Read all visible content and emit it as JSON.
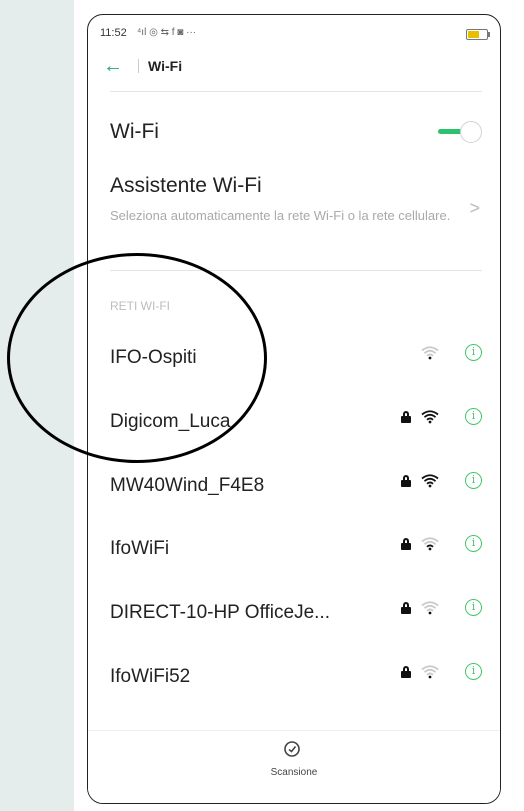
{
  "status": {
    "time": "11:52",
    "icons": "⁴ıl ◎ ⇆ f ◙ ···"
  },
  "toolbar": {
    "title": "Wi-Fi"
  },
  "wifi_toggle": {
    "label": "Wi-Fi",
    "enabled": true,
    "accent": "#2bc16f"
  },
  "assistant": {
    "title": "Assistente Wi-Fi",
    "description": "Seleziona automaticamente la rete Wi-Fi o la rete cellulare."
  },
  "networks_section": {
    "header": "RETI WI-FI",
    "items": [
      {
        "name": "IFO-Ospiti",
        "locked": false,
        "signal": 1
      },
      {
        "name": "Digicom_Luca",
        "locked": true,
        "signal": 4
      },
      {
        "name": "MW40Wind_F4E8",
        "locked": true,
        "signal": 4
      },
      {
        "name": "IfoWiFi",
        "locked": true,
        "signal": 2
      },
      {
        "name": "DIRECT-10-HP OfficeJe...",
        "locked": true,
        "signal": 1
      },
      {
        "name": "IfoWiFi52",
        "locked": true,
        "signal": 1
      }
    ]
  },
  "bottom": {
    "scan_label": "Scansione"
  },
  "icons": {
    "back": "arrow-left-icon",
    "info": "info-icon",
    "scan": "scan-icon",
    "lock": "lock-icon",
    "wifi": "wifi-signal-icon"
  }
}
